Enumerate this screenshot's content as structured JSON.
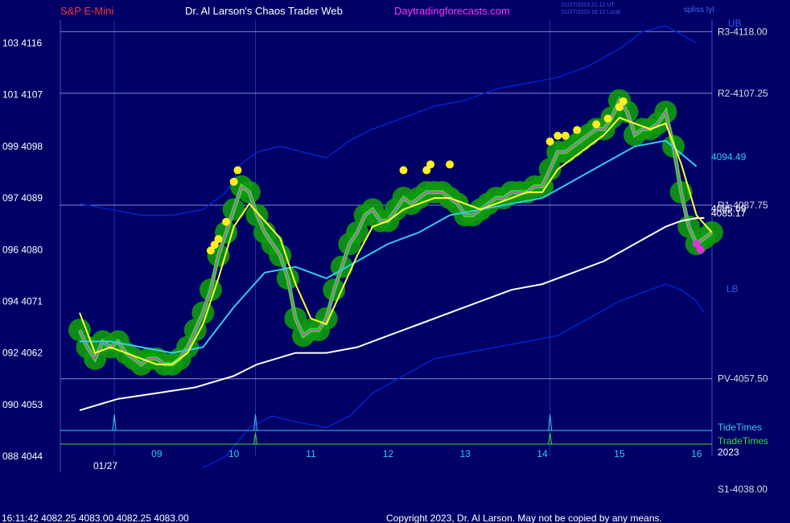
{
  "header": {
    "left_title": "S&P E-Mini",
    "center_title": "Dr. Al Larson's Chaos Trader Web",
    "site": "Daytradingforecasts.com",
    "update_line1": "01/27/2023 21:12 UT",
    "update_line2": "01/27/2023 16:12 Local",
    "corner_tag": "spliss tyl"
  },
  "footer": {
    "quote_line": "16:11:42  4082.25 4083.00 4082.25 4083.00",
    "copyright": "Copyright 2023, Dr. Al Larson. May not be copied by any means."
  },
  "colors": {
    "background": "#000066",
    "price": "#33dd33",
    "price_halo": "#119911",
    "fast_ma": "#ffff33",
    "mid_ma": "#33ccee",
    "slow_ma": "#ffffff",
    "band": "#0022cc",
    "pivot_line": "#8888cc",
    "tide": "#33ccee",
    "trade": "#33dd33",
    "left_title": "#ff3333",
    "site": "#ff33ff"
  },
  "chart_data": {
    "type": "line",
    "instrument": "S&P E-Mini",
    "ylim": [
      4044,
      4120
    ],
    "x_day_labels": [
      "09",
      "10",
      "11",
      "12",
      "13",
      "14",
      "15",
      "16"
    ],
    "x_date_label": "01/27",
    "x_year_label": "2023",
    "y_ticks": [
      {
        "label": "103  4116",
        "value": 4116
      },
      {
        "label": "101  4107",
        "value": 4107
      },
      {
        "label": "099  4098",
        "value": 4098
      },
      {
        "label": "097  4089",
        "value": 4089
      },
      {
        "label": "096  4080",
        "value": 4080
      },
      {
        "label": "094  4071",
        "value": 4071
      },
      {
        "label": "092  4062",
        "value": 4062
      },
      {
        "label": "090  4053",
        "value": 4053
      },
      {
        "label": "088  4044",
        "value": 4044
      }
    ],
    "levels": [
      {
        "name": "R3",
        "label": "R3-4118.00",
        "value": 4118.0
      },
      {
        "name": "R2",
        "label": "R2-4107.25",
        "value": 4107.25
      },
      {
        "name": "R1",
        "label": "R1-4087.75",
        "value": 4087.75
      },
      {
        "name": "PV",
        "label": "PV-4057.50",
        "value": 4057.5
      },
      {
        "name": "S1",
        "label": "S1-4038.00",
        "value": 4038.0
      }
    ],
    "band_labels": {
      "upper": "UB",
      "lower": "LB"
    },
    "value_labels": {
      "mid_ma": "4094.49",
      "slow_a": "4085.69",
      "slow_b": "4085.17"
    },
    "time_labels": {
      "tide": "TideTimes",
      "trade": "TradeTimes"
    },
    "price_series": [
      [
        8.0,
        4066
      ],
      [
        8.1,
        4063
      ],
      [
        8.2,
        4061
      ],
      [
        8.3,
        4064
      ],
      [
        8.4,
        4063
      ],
      [
        8.5,
        4064
      ],
      [
        8.6,
        4062
      ],
      [
        8.7,
        4061
      ],
      [
        8.8,
        4060
      ],
      [
        8.9,
        4061
      ],
      [
        9.0,
        4061
      ],
      [
        9.1,
        4060
      ],
      [
        9.2,
        4060
      ],
      [
        9.3,
        4061
      ],
      [
        9.4,
        4063
      ],
      [
        9.5,
        4066
      ],
      [
        9.6,
        4069
      ],
      [
        9.7,
        4073
      ],
      [
        9.8,
        4079
      ],
      [
        9.9,
        4083
      ],
      [
        10.0,
        4087
      ],
      [
        10.1,
        4091
      ],
      [
        10.2,
        4090
      ],
      [
        10.3,
        4086
      ],
      [
        10.4,
        4083
      ],
      [
        10.5,
        4081
      ],
      [
        10.6,
        4079
      ],
      [
        10.7,
        4075
      ],
      [
        10.8,
        4068
      ],
      [
        10.9,
        4065
      ],
      [
        11.0,
        4066
      ],
      [
        11.1,
        4066
      ],
      [
        11.2,
        4068
      ],
      [
        11.3,
        4073
      ],
      [
        11.4,
        4077
      ],
      [
        11.5,
        4081
      ],
      [
        11.6,
        4083
      ],
      [
        11.7,
        4086
      ],
      [
        11.8,
        4087
      ],
      [
        11.9,
        4085
      ],
      [
        12.0,
        4085
      ],
      [
        12.1,
        4087
      ],
      [
        12.2,
        4089
      ],
      [
        12.3,
        4088
      ],
      [
        12.4,
        4089
      ],
      [
        12.5,
        4090
      ],
      [
        12.6,
        4090
      ],
      [
        12.7,
        4090
      ],
      [
        12.8,
        4089
      ],
      [
        12.9,
        4088
      ],
      [
        13.0,
        4086
      ],
      [
        13.1,
        4086
      ],
      [
        13.2,
        4087
      ],
      [
        13.3,
        4088
      ],
      [
        13.4,
        4089
      ],
      [
        13.5,
        4089
      ],
      [
        13.6,
        4090
      ],
      [
        13.7,
        4090
      ],
      [
        13.8,
        4090
      ],
      [
        13.9,
        4091
      ],
      [
        14.0,
        4091
      ],
      [
        14.1,
        4094
      ],
      [
        14.2,
        4097
      ],
      [
        14.3,
        4097
      ],
      [
        14.4,
        4098
      ],
      [
        14.5,
        4099
      ],
      [
        14.6,
        4100
      ],
      [
        14.7,
        4101
      ],
      [
        14.8,
        4101
      ],
      [
        14.9,
        4103
      ],
      [
        15.0,
        4106
      ],
      [
        15.1,
        4104
      ],
      [
        15.2,
        4100
      ],
      [
        15.3,
        4101
      ],
      [
        15.4,
        4101
      ],
      [
        15.5,
        4102
      ],
      [
        15.6,
        4104
      ],
      [
        15.7,
        4098
      ],
      [
        15.8,
        4090
      ],
      [
        15.9,
        4084
      ],
      [
        16.0,
        4081
      ],
      [
        16.1,
        4082
      ],
      [
        16.2,
        4083
      ]
    ],
    "fast_ma": [
      [
        8.0,
        4069
      ],
      [
        8.2,
        4062
      ],
      [
        8.4,
        4063
      ],
      [
        8.6,
        4062
      ],
      [
        8.8,
        4061
      ],
      [
        9.0,
        4060
      ],
      [
        9.2,
        4060
      ],
      [
        9.4,
        4062
      ],
      [
        9.6,
        4067
      ],
      [
        9.8,
        4075
      ],
      [
        10.0,
        4084
      ],
      [
        10.2,
        4088
      ],
      [
        10.4,
        4085
      ],
      [
        10.6,
        4082
      ],
      [
        10.8,
        4074
      ],
      [
        11.0,
        4068
      ],
      [
        11.2,
        4067
      ],
      [
        11.4,
        4073
      ],
      [
        11.6,
        4079
      ],
      [
        11.8,
        4084
      ],
      [
        12.0,
        4085
      ],
      [
        12.2,
        4087
      ],
      [
        12.4,
        4088
      ],
      [
        12.6,
        4089
      ],
      [
        12.8,
        4089
      ],
      [
        13.0,
        4088
      ],
      [
        13.2,
        4087
      ],
      [
        13.4,
        4088
      ],
      [
        13.6,
        4089
      ],
      [
        13.8,
        4090
      ],
      [
        14.0,
        4090
      ],
      [
        14.2,
        4094
      ],
      [
        14.4,
        4096
      ],
      [
        14.6,
        4098
      ],
      [
        14.8,
        4100
      ],
      [
        15.0,
        4103
      ],
      [
        15.2,
        4102
      ],
      [
        15.4,
        4101
      ],
      [
        15.6,
        4102
      ],
      [
        15.8,
        4095
      ],
      [
        16.0,
        4086
      ],
      [
        16.2,
        4083
      ]
    ],
    "mid_ma": [
      [
        8.0,
        4064
      ],
      [
        8.4,
        4064
      ],
      [
        8.8,
        4063
      ],
      [
        9.2,
        4062
      ],
      [
        9.6,
        4063
      ],
      [
        10.0,
        4070
      ],
      [
        10.4,
        4076
      ],
      [
        10.8,
        4077
      ],
      [
        11.2,
        4075
      ],
      [
        11.6,
        4078
      ],
      [
        12.0,
        4081
      ],
      [
        12.4,
        4083
      ],
      [
        12.8,
        4086
      ],
      [
        13.2,
        4087
      ],
      [
        13.6,
        4088
      ],
      [
        14.0,
        4089
      ],
      [
        14.4,
        4092
      ],
      [
        14.8,
        4095
      ],
      [
        15.2,
        4098
      ],
      [
        15.6,
        4099
      ],
      [
        16.0,
        4094.5
      ]
    ],
    "slow_ma": [
      [
        8.0,
        4052
      ],
      [
        8.5,
        4054
      ],
      [
        9.0,
        4055
      ],
      [
        9.5,
        4056
      ],
      [
        10.0,
        4058
      ],
      [
        10.3,
        4060
      ],
      [
        10.8,
        4062
      ],
      [
        11.2,
        4062
      ],
      [
        11.6,
        4063
      ],
      [
        12.0,
        4065
      ],
      [
        12.4,
        4067
      ],
      [
        12.8,
        4069
      ],
      [
        13.2,
        4071
      ],
      [
        13.6,
        4073
      ],
      [
        14.0,
        4074
      ],
      [
        14.4,
        4076
      ],
      [
        14.8,
        4078
      ],
      [
        15.2,
        4081
      ],
      [
        15.6,
        4084
      ],
      [
        15.8,
        4085
      ],
      [
        16.0,
        4085.5
      ],
      [
        16.1,
        4085.5
      ]
    ],
    "upper_band": [
      [
        8.0,
        4088
      ],
      [
        8.4,
        4087
      ],
      [
        8.8,
        4086
      ],
      [
        9.2,
        4086
      ],
      [
        9.6,
        4087
      ],
      [
        9.9,
        4090
      ],
      [
        10.1,
        4095
      ],
      [
        10.3,
        4097
      ],
      [
        10.6,
        4098
      ],
      [
        10.9,
        4097
      ],
      [
        11.2,
        4096
      ],
      [
        11.5,
        4099
      ],
      [
        11.8,
        4101
      ],
      [
        12.2,
        4103
      ],
      [
        12.6,
        4105
      ],
      [
        13.0,
        4106
      ],
      [
        13.4,
        4108
      ],
      [
        13.8,
        4109
      ],
      [
        14.2,
        4110
      ],
      [
        14.6,
        4112
      ],
      [
        15.0,
        4115
      ],
      [
        15.3,
        4118
      ],
      [
        15.6,
        4119
      ],
      [
        16.0,
        4116
      ]
    ],
    "lower_band": [
      [
        9.6,
        4042
      ],
      [
        9.9,
        4044
      ],
      [
        10.2,
        4049
      ],
      [
        10.5,
        4051
      ],
      [
        10.8,
        4050
      ],
      [
        11.2,
        4049
      ],
      [
        11.5,
        4051
      ],
      [
        11.8,
        4055
      ],
      [
        12.2,
        4058
      ],
      [
        12.6,
        4061
      ],
      [
        13.0,
        4062
      ],
      [
        13.4,
        4063
      ],
      [
        13.8,
        4064
      ],
      [
        14.2,
        4065
      ],
      [
        14.6,
        4068
      ],
      [
        15.0,
        4071
      ],
      [
        15.4,
        4073
      ],
      [
        15.6,
        4074
      ],
      [
        15.8,
        4073
      ],
      [
        16.0,
        4071
      ],
      [
        16.1,
        4069
      ]
    ],
    "highlight_points": [
      [
        9.7,
        4079
      ],
      [
        9.75,
        4080
      ],
      [
        9.8,
        4081
      ],
      [
        9.9,
        4084
      ],
      [
        10.0,
        4091
      ],
      [
        10.05,
        4093
      ],
      [
        12.2,
        4093
      ],
      [
        12.5,
        4093
      ],
      [
        12.55,
        4094
      ],
      [
        12.8,
        4094
      ],
      [
        14.1,
        4098
      ],
      [
        14.2,
        4099
      ],
      [
        14.3,
        4099
      ],
      [
        14.45,
        4100
      ],
      [
        14.7,
        4101
      ],
      [
        14.85,
        4102
      ],
      [
        15.0,
        4104
      ],
      [
        15.05,
        4105
      ]
    ],
    "tide_times": [
      8.45,
      10.28,
      14.1
    ],
    "trade_times": [
      10.28,
      14.1
    ]
  }
}
